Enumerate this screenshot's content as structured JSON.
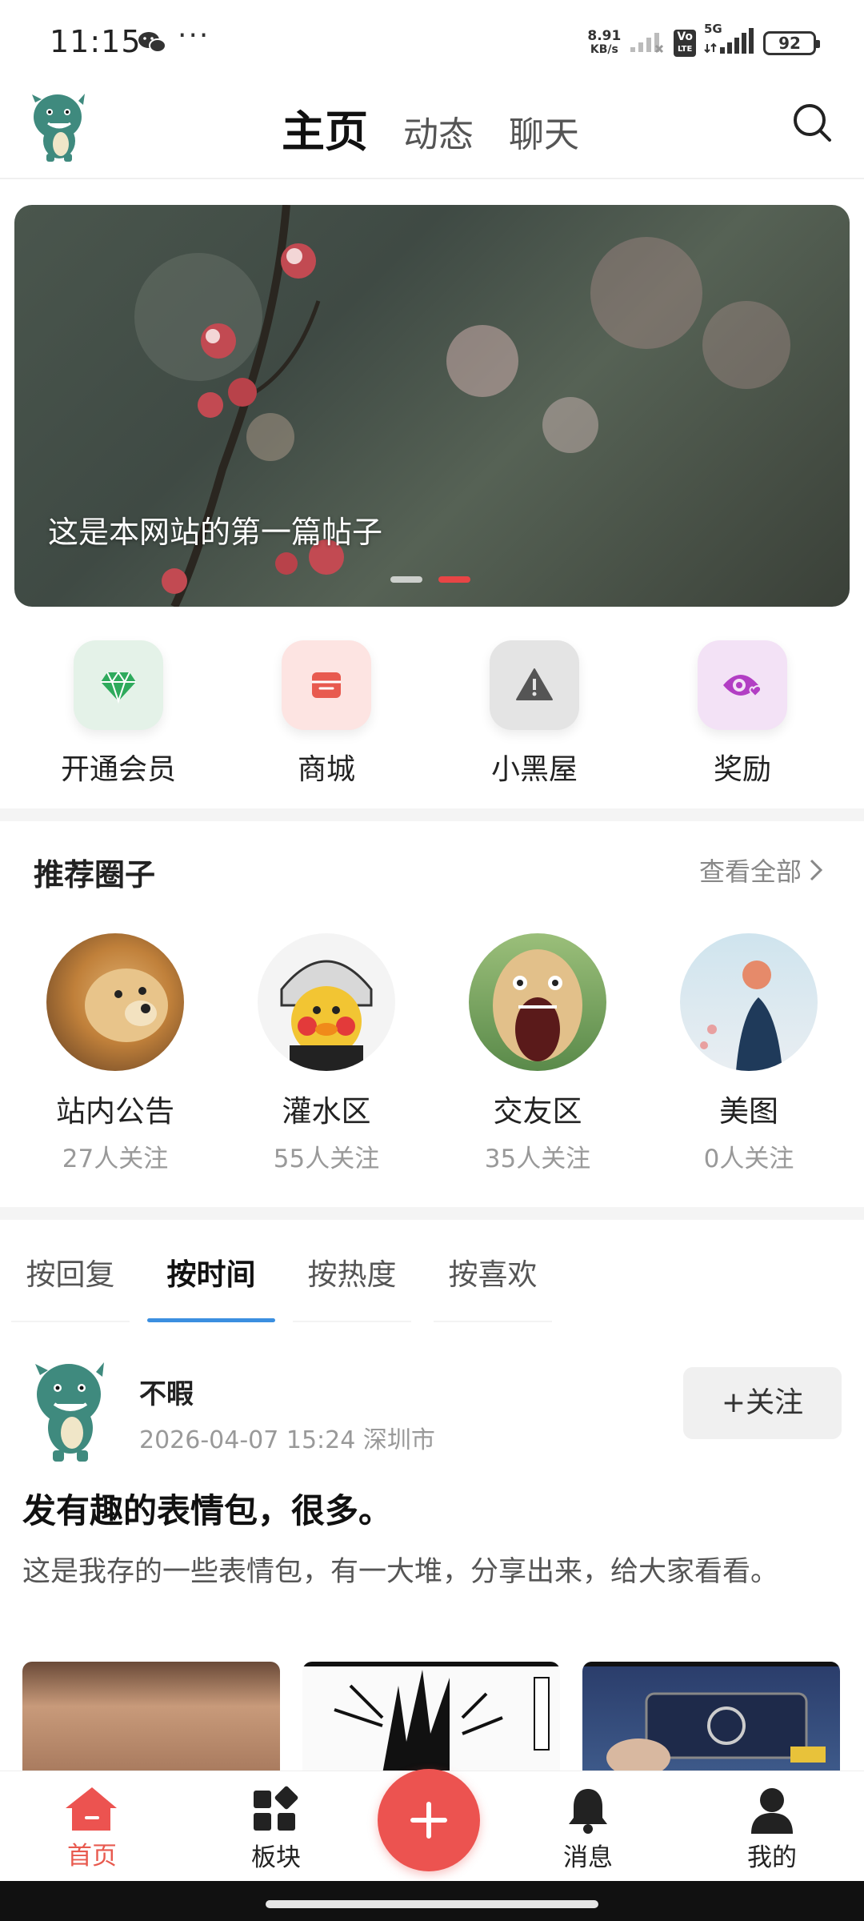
{
  "status_bar": {
    "time": "11:15",
    "more": "···",
    "net_speed_value": "8.91",
    "net_speed_unit": "KB/s",
    "volte_top": "Vo",
    "volte_bottom": "LTE",
    "network": "5G",
    "battery": "92"
  },
  "header": {
    "tabs": [
      {
        "label": "主页",
        "active": true
      },
      {
        "label": "动态",
        "active": false
      },
      {
        "label": "聊天",
        "active": false
      }
    ]
  },
  "banner": {
    "caption": "这是本网站的第一篇帖子",
    "slide_count": 2,
    "active_slide": 2
  },
  "quick_actions": [
    {
      "label": "开通会员",
      "icon": "diamond-icon",
      "bg": "#e4f2e8",
      "color": "#2eaa5c"
    },
    {
      "label": "商城",
      "icon": "store-icon",
      "bg": "#fde4e2",
      "color": "#e85a4f"
    },
    {
      "label": "小黑屋",
      "icon": "warning-icon",
      "bg": "#e4e4e4",
      "color": "#555555"
    },
    {
      "label": "奖励",
      "icon": "eye-heart-icon",
      "bg": "#f3e2f6",
      "color": "#b23ec4"
    }
  ],
  "recommended": {
    "title": "推荐圈子",
    "view_all": "查看全部",
    "circles": [
      {
        "name": "站内公告",
        "followers": "27人关注"
      },
      {
        "name": "灌水区",
        "followers": "55人关注"
      },
      {
        "name": "交友区",
        "followers": "35人关注"
      },
      {
        "name": "美图",
        "followers": "0人关注"
      }
    ]
  },
  "sort_tabs": [
    {
      "label": "按回复",
      "active": false
    },
    {
      "label": "按时间",
      "active": true
    },
    {
      "label": "按热度",
      "active": false
    },
    {
      "label": "按喜欢",
      "active": false
    }
  ],
  "post": {
    "author": "不暇",
    "meta": "2026-04-07 15:24 深圳市",
    "follow_label": "+关注",
    "title": "发有趣的表情包，很多。",
    "body": "这是我存的一些表情包，有一大堆，分享出来，给大家看看。"
  },
  "bottom_nav": [
    {
      "label": "首页",
      "icon": "home-icon",
      "active": true
    },
    {
      "label": "板块",
      "icon": "grid-icon",
      "active": false
    },
    {
      "label": "消息",
      "icon": "bell-icon",
      "active": false
    },
    {
      "label": "我的",
      "icon": "user-icon",
      "active": false
    }
  ],
  "colors": {
    "accent_red": "#ec5350",
    "tab_underline": "#3b8fe0",
    "muted_text": "#999999"
  }
}
